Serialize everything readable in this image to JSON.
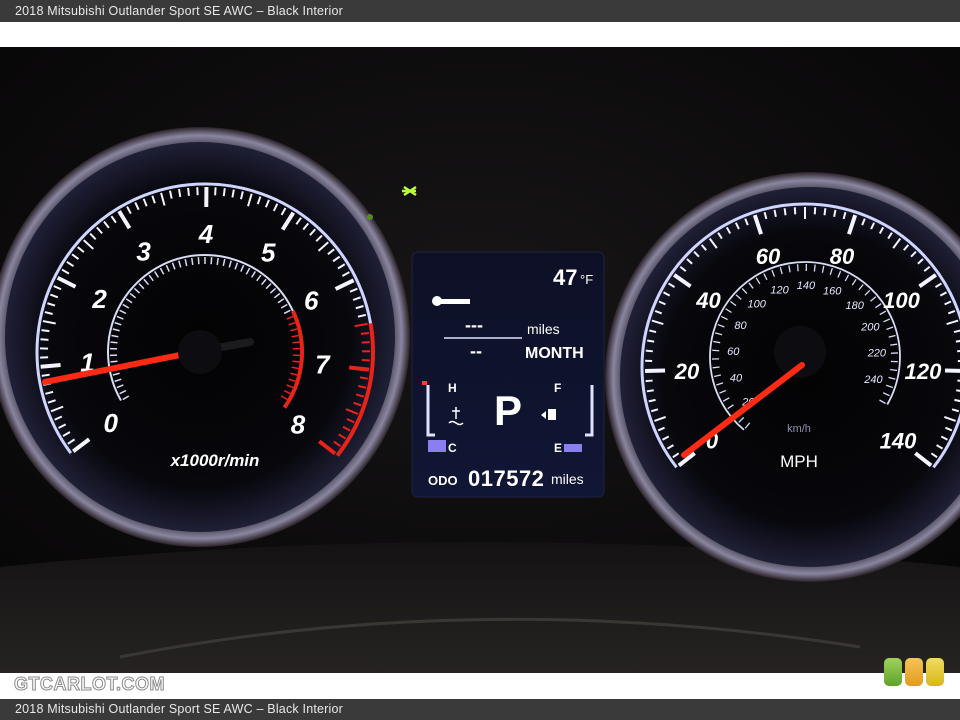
{
  "caption": "2018 Mitsubishi Outlander Sport SE AWC – Black Interior",
  "watermark": "GTCARLOT.COM",
  "tachometer": {
    "labels": [
      "0",
      "1",
      "2",
      "3",
      "4",
      "5",
      "6",
      "7",
      "8"
    ],
    "unit": "x1000r/min"
  },
  "display": {
    "temperature": "47",
    "temperature_unit": "°F",
    "service_distance": "---",
    "service_distance_unit": "miles",
    "service_interval": "--",
    "service_interval_unit": "MONTH",
    "gear": "P",
    "temp_hot": "H",
    "temp_cold": "C",
    "fuel_full": "F",
    "fuel_empty": "E",
    "odo_label": "ODO",
    "odometer": "017572",
    "odometer_unit": "miles"
  },
  "speedometer": {
    "mph_labels": [
      "0",
      "20",
      "40",
      "60",
      "80",
      "100",
      "120",
      "140"
    ],
    "kmh_labels": [
      "20",
      "40",
      "60",
      "80",
      "100",
      "120",
      "140",
      "160",
      "180",
      "200",
      "220",
      "240"
    ],
    "kmh_unit": "km/h",
    "unit": "MPH"
  },
  "colors": {
    "needle": "#ff2a14",
    "redline": "#e8231a",
    "dial_ring": "#cfd5ff",
    "indicator_green": "#b6ff3c"
  }
}
